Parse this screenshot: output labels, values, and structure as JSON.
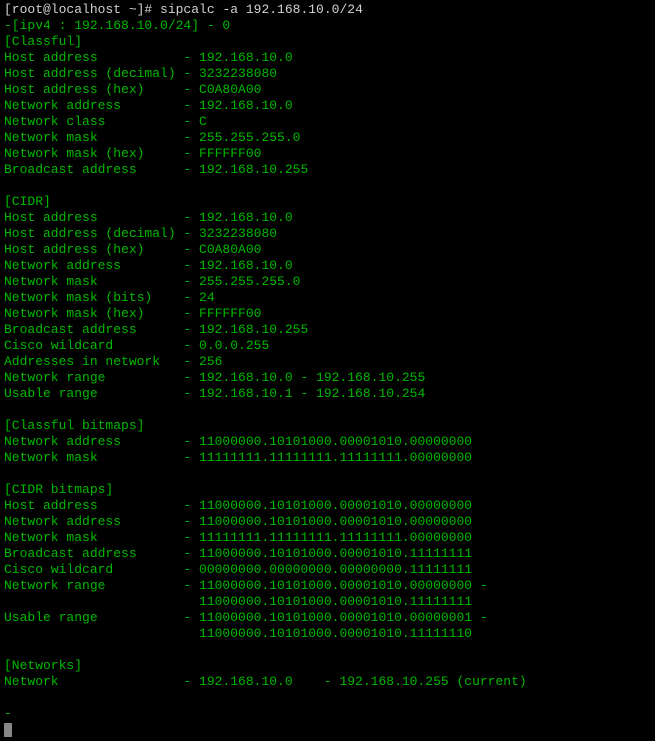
{
  "prompt": "[root@localhost ~]# ",
  "command": "sipcalc -a 192.168.10.0/24",
  "header": "-[ipv4 : 192.168.10.0/24] - 0",
  "blank": "",
  "sections": {
    "classful": {
      "title": "[Classful]",
      "rows": [
        {
          "label": "Host address",
          "value": "192.168.10.0"
        },
        {
          "label": "Host address (decimal)",
          "value": "3232238080"
        },
        {
          "label": "Host address (hex)",
          "value": "C0A80A00"
        },
        {
          "label": "Network address",
          "value": "192.168.10.0"
        },
        {
          "label": "Network class",
          "value": "C"
        },
        {
          "label": "Network mask",
          "value": "255.255.255.0"
        },
        {
          "label": "Network mask (hex)",
          "value": "FFFFFF00"
        },
        {
          "label": "Broadcast address",
          "value": "192.168.10.255"
        }
      ]
    },
    "cidr": {
      "title": "[CIDR]",
      "rows": [
        {
          "label": "Host address",
          "value": "192.168.10.0"
        },
        {
          "label": "Host address (decimal)",
          "value": "3232238080"
        },
        {
          "label": "Host address (hex)",
          "value": "C0A80A00"
        },
        {
          "label": "Network address",
          "value": "192.168.10.0"
        },
        {
          "label": "Network mask",
          "value": "255.255.255.0"
        },
        {
          "label": "Network mask (bits)",
          "value": "24"
        },
        {
          "label": "Network mask (hex)",
          "value": "FFFFFF00"
        },
        {
          "label": "Broadcast address",
          "value": "192.168.10.255"
        },
        {
          "label": "Cisco wildcard",
          "value": "0.0.0.255"
        },
        {
          "label": "Addresses in network",
          "value": "256"
        },
        {
          "label": "Network range",
          "value": "192.168.10.0 - 192.168.10.255"
        },
        {
          "label": "Usable range",
          "value": "192.168.10.1 - 192.168.10.254"
        }
      ]
    },
    "classful_bitmaps": {
      "title": "[Classful bitmaps]",
      "rows": [
        {
          "label": "Network address",
          "value": "11000000.10101000.00001010.00000000"
        },
        {
          "label": "Network mask",
          "value": "11111111.11111111.11111111.00000000"
        }
      ]
    },
    "cidr_bitmaps": {
      "title": "[CIDR bitmaps]",
      "rows": [
        {
          "label": "Host address",
          "value": "11000000.10101000.00001010.00000000"
        },
        {
          "label": "Network address",
          "value": "11000000.10101000.00001010.00000000"
        },
        {
          "label": "Network mask",
          "value": "11111111.11111111.11111111.00000000"
        },
        {
          "label": "Broadcast address",
          "value": "11000000.10101000.00001010.11111111"
        },
        {
          "label": "Cisco wildcard",
          "value": "00000000.00000000.00000000.11111111"
        },
        {
          "label": "Network range",
          "value": "11000000.10101000.00001010.00000000 -",
          "cont": "11000000.10101000.00001010.11111111"
        },
        {
          "label": "Usable range",
          "value": "11000000.10101000.00001010.00000001 -",
          "cont": "11000000.10101000.00001010.11111110"
        }
      ]
    },
    "networks": {
      "title": "[Networks]",
      "rows": [
        {
          "label": "Network",
          "value": "192.168.10.0    - 192.168.10.255 (current)"
        }
      ]
    }
  },
  "dash": "-"
}
